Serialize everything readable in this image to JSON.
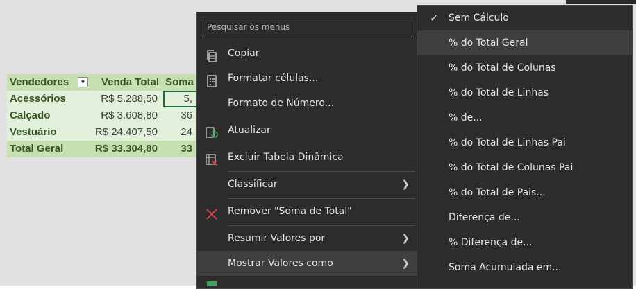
{
  "pivot": {
    "headers": [
      "Vendedores",
      "Venda Total",
      "Soma"
    ],
    "rows": [
      {
        "label": "Acessórios",
        "venda": "R$ 5.288,50",
        "soma": "5,"
      },
      {
        "label": "Calçado",
        "venda": "R$ 3.608,80",
        "soma": "36"
      },
      {
        "label": "Vestuário",
        "venda": "R$ 24.407,50",
        "soma": "24"
      }
    ],
    "total": {
      "label": "Total Geral",
      "venda": "R$ 33.304,80",
      "soma": "33"
    }
  },
  "context_menu": {
    "search_placeholder": "Pesquisar os menus",
    "items": [
      {
        "label": "Copiar",
        "icon": "copy-icon"
      },
      {
        "label": "Formatar células...",
        "icon": "format-cells-icon"
      },
      {
        "label": "Formato de Número...",
        "icon": ""
      },
      {
        "label": "Atualizar",
        "icon": "refresh-icon"
      },
      {
        "label": "Excluir Tabela Dinâmica",
        "icon": "delete-pivot-icon"
      },
      {
        "label": "Classificar",
        "icon": ""
      },
      {
        "label": "Remover \"Soma de Total\"",
        "icon": "remove-x-icon"
      },
      {
        "label": "Resumir Valores por",
        "icon": ""
      },
      {
        "label": "Mostrar Valores como",
        "icon": ""
      }
    ]
  },
  "submenu": {
    "items": [
      {
        "label": "Sem Cálculo",
        "checked": true
      },
      {
        "label": "% do Total Geral"
      },
      {
        "label": "% do Total de Colunas"
      },
      {
        "label": "% do Total de Linhas"
      },
      {
        "label": "% de..."
      },
      {
        "label": "% do Total de Linhas Pai"
      },
      {
        "label": "% do Total de Colunas Pai"
      },
      {
        "label": "% do Total de Pais..."
      },
      {
        "label": "Diferença de..."
      },
      {
        "label": "% Diferença de..."
      },
      {
        "label": "Soma Acumulada em..."
      }
    ]
  },
  "colors": {
    "pivot_header": "#c6e0b4",
    "pivot_row": "#e2efda",
    "menu_bg": "#2c2c2c",
    "menu_highlight": "#3e3e3e",
    "remove_icon": "#e04a4a",
    "refresh_icon": "#3fa35a"
  }
}
